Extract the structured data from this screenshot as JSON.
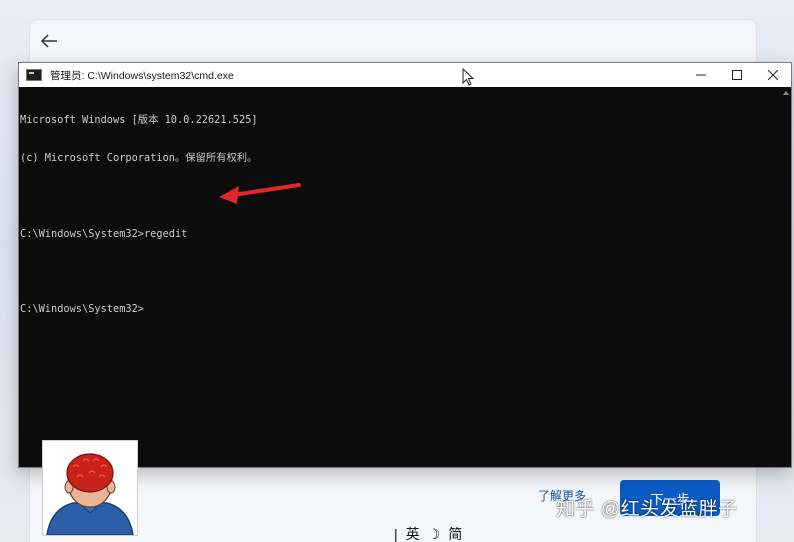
{
  "setup": {
    "learn_more": "了解更多",
    "next_button": "下一步"
  },
  "cmd": {
    "title": "管理员: C:\\Windows\\system32\\cmd.exe",
    "lines": [
      "Microsoft Windows [版本 10.0.22621.525]",
      "(c) Microsoft Corporation。保留所有权利。",
      "",
      "C:\\Windows\\System32>regedit",
      "",
      "C:\\Windows\\System32>"
    ]
  },
  "ime": {
    "separator": "|",
    "mode": "英",
    "moon": "☽",
    "script": "简"
  },
  "watermark": "知乎 @红头发蓝胖子",
  "colors": {
    "console_bg": "#0c0c0c",
    "console_text": "#cccccc",
    "arrow": "#e0262b",
    "accent": "#0a5bc4"
  }
}
